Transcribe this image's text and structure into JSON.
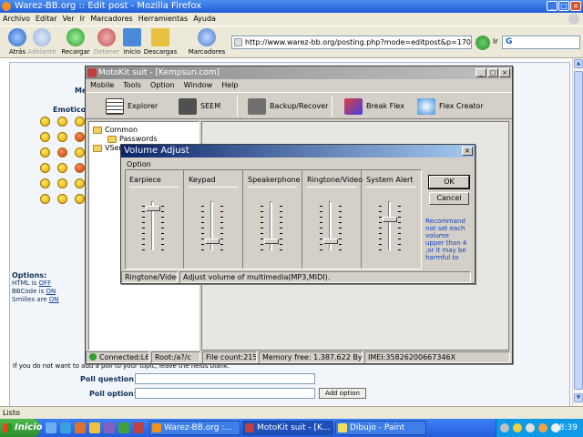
{
  "firefox": {
    "title": "Warez-BB.org :: Edit post - Mozilla Firefox",
    "menu": [
      "Archivo",
      "Editar",
      "Ver",
      "Ir",
      "Marcadores",
      "Herramientas",
      "Ayuda"
    ],
    "nav": {
      "back": "Atrás",
      "forward": "Adelante",
      "reload": "Recargar",
      "stop": "Detener",
      "home": "Inicio",
      "downloads": "Descargas",
      "bookmarks": "Marcadores"
    },
    "url": "http://www.warez-bb.org/posting.php?mode=editpost&p=17099",
    "go_label": "Ir",
    "search_value": "G",
    "status": "Listo"
  },
  "webpage": {
    "label_me": "Me",
    "label_emoticons": "Emoticon",
    "options_title": "Options:",
    "options": [
      {
        "label": "HTML is",
        "value": "OFF"
      },
      {
        "label": "BBCode is",
        "value": "ON"
      },
      {
        "label": "Smilies are",
        "value": "ON"
      }
    ],
    "poll_note": "If you do not want to add a poll to your topic, leave the fields blank.",
    "poll_question_label": "Poll question:",
    "poll_option_label": "Poll option:",
    "add_option_button": "Add option"
  },
  "motokit": {
    "title": "MotoKit suit - [Kempsun.com]",
    "menu": [
      "Mobile",
      "Tools",
      "Option",
      "Window",
      "Help"
    ],
    "toolbar": [
      "Explorer",
      "SEEM",
      "Backup/Recover",
      "Break Flex",
      "Flex Creator"
    ],
    "tree": [
      "Common",
      "Passwords",
      "VSer"
    ],
    "status": {
      "connected": "Connected:L6",
      "root": "Root:/a?/c",
      "file_count": "File count:215",
      "memory": "Memory free: 1.387.622 Bytes",
      "imei": "IMEI:35826200667346X"
    }
  },
  "volume_dialog": {
    "title": "Volume Adjust",
    "group_label": "Option",
    "channels": [
      {
        "label": "Earpiece",
        "level": 0.9
      },
      {
        "label": "Keypad",
        "level": 0.15
      },
      {
        "label": "Speakerphone",
        "level": 0.15
      },
      {
        "label": "Ringtone/Video",
        "level": 0.15
      },
      {
        "label": "System Alert",
        "level": 0.65
      }
    ],
    "ok_button": "OK",
    "cancel_button": "Cancel",
    "info_text": "Recommand not set each volume upper than 4 ,or it may be harmful to",
    "status_channel": "Ringtone/Video",
    "status_desc": "Adjust volume of multimedia(MP3,MIDI)."
  },
  "taskbar": {
    "start_label": "Inicio",
    "tasks": [
      "Warez-BB.org :...",
      "MotoKit suit - [K...",
      "Dibujo - Paint"
    ],
    "clock": "8:39"
  }
}
